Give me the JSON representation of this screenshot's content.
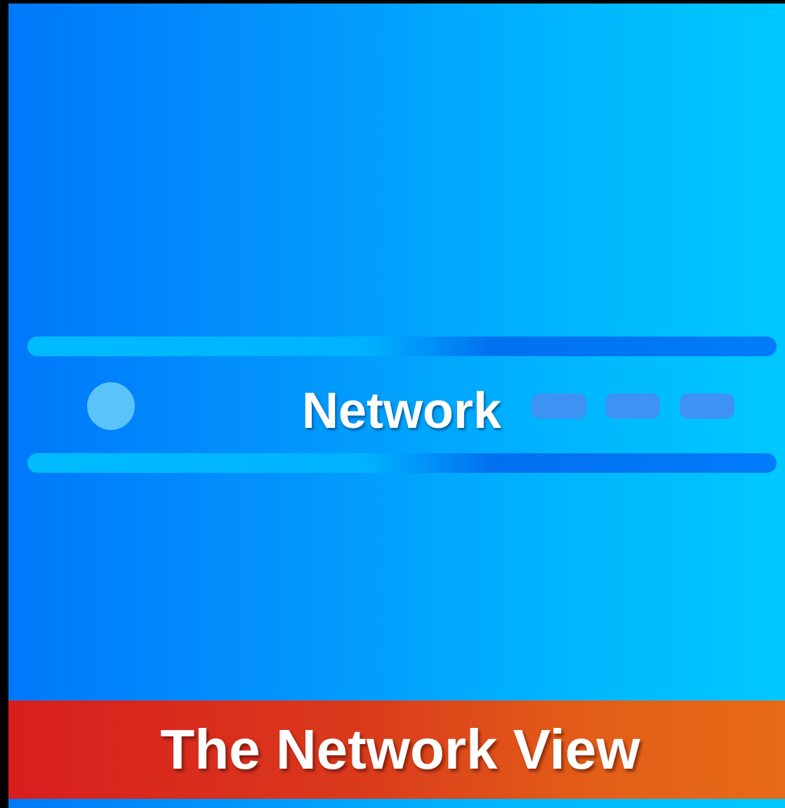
{
  "device": {
    "label": "Network",
    "status_dot_color": "#5ac3fa",
    "indicator_color": "#3d92f3",
    "indicators": 3
  },
  "banner": {
    "title": "The Network View",
    "color_start": "#d81e1e",
    "color_end": "#e66a17"
  },
  "background": {
    "gradient_start": "#0078fa",
    "gradient_end": "#00c8ff"
  }
}
